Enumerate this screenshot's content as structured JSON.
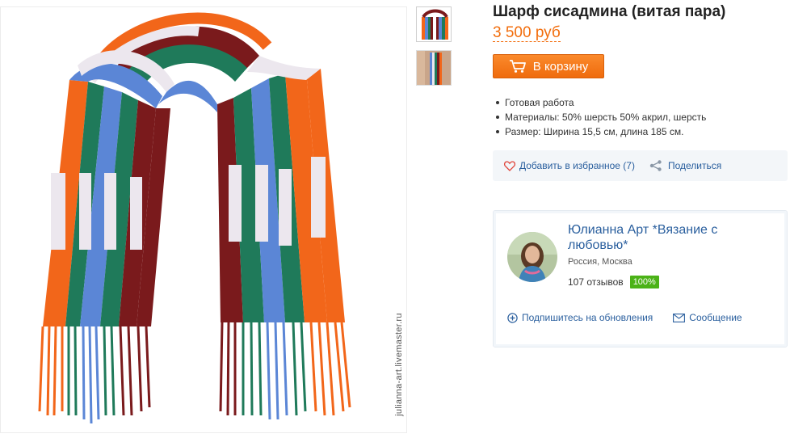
{
  "product": {
    "title": "Шарф сисадмина (витая пара)",
    "price": "3 500 руб",
    "cart_button": "В корзину",
    "features": [
      "Готовая работа",
      "Материалы: 50% шерсть 50% акрил, шерсть",
      "Размер: Ширина 15,5 см, длина 185 см."
    ]
  },
  "gallery": {
    "watermark": "julianna-art.livemaster.ru",
    "thumb_count": 2
  },
  "actions": {
    "favorite": "Добавить в избранное (7)",
    "share": "Поделиться"
  },
  "seller": {
    "name": "Юлианна Арт *Вязание с любовью*",
    "location": "Россия, Москва",
    "reviews": "107 отзывов",
    "rating_badge": "100%",
    "subscribe": "Подпишитесь на обновления",
    "message": "Сообщение"
  },
  "icons": {
    "cart": "cart-icon",
    "favorite": "heart-icon",
    "share": "share-icon",
    "subscribe": "plus-circle-icon",
    "message": "envelope-icon"
  },
  "colors": {
    "accent": "#f26d0c",
    "link": "#2a5f9e",
    "badge": "#4bb217",
    "scarf_orange": "#f2661a",
    "scarf_blue": "#5b86d6",
    "scarf_green": "#1f7a5a",
    "scarf_maroon": "#7a1a1c",
    "scarf_white": "#ece7ee"
  }
}
